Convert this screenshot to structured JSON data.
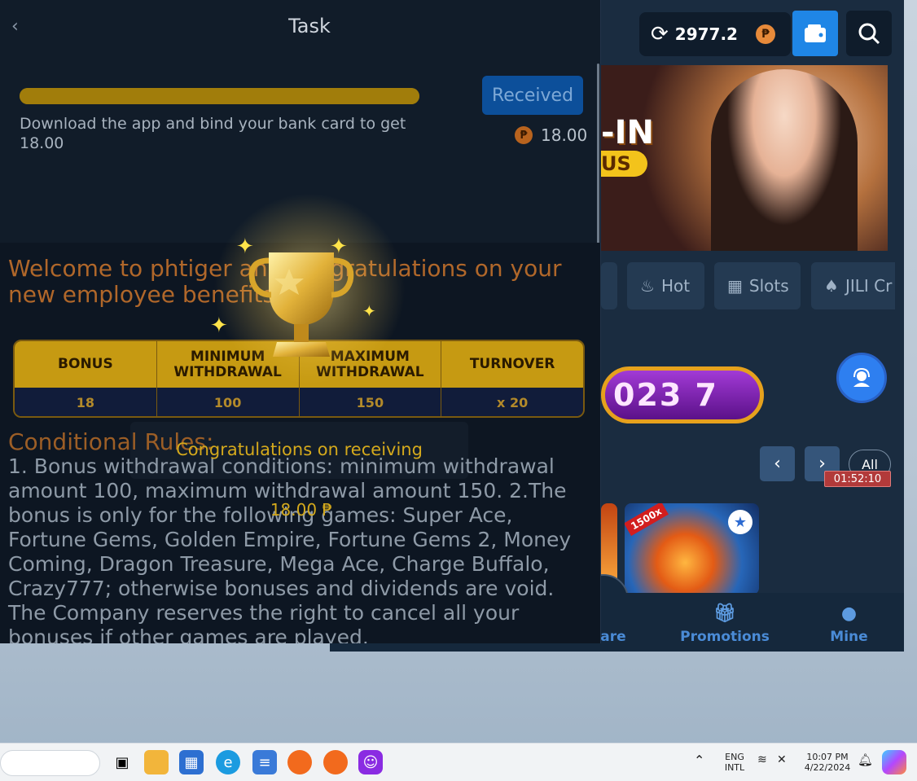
{
  "task_panel": {
    "title": "Task",
    "back_icon": "‹",
    "task": {
      "description": "Download the app and bind your bank card to get 18.00",
      "progress": 1.0,
      "button_label": "Received",
      "reward_amount": "18.00",
      "reward_currency_symbol": "₱"
    },
    "welcome": "Welcome to phtiger and congratulations on your new employee benefits",
    "bonus_table": {
      "headers": [
        "BONUS",
        "MINIMUM WITHDRAWAL",
        "MAXIMUM WITHDRAWAL",
        "TURNOVER"
      ],
      "values": [
        "18",
        "100",
        "150",
        "x 20"
      ]
    },
    "rules_title": "Conditional Rules:",
    "rules_text": "1. Bonus withdrawal conditions: minimum withdrawal amount 100, maximum withdrawal amount 150. 2.The bonus is only for the following games: Super Ace, Fortune Gems, Golden Empire, Fortune Gems 2, Money Coming, Dragon Treasure, Mega Ace, Charge Buffalo, Crazy777; otherwise bonuses and dividends are void. The Company reserves the right to cancel all your bonuses if other games are played.",
    "popup": {
      "message": "Congratulations on receiving",
      "amount": "18.00 ₱"
    }
  },
  "bg_app": {
    "balance": "2977.2",
    "currency_symbol": "₱",
    "banner_text": "-IN",
    "banner_badge": "US",
    "categories": [
      {
        "label": "Hot",
        "icon": "fire-icon"
      },
      {
        "label": "Slots",
        "icon": "slots-icon"
      },
      {
        "label": "JILI Cr",
        "icon": "cards-icon"
      }
    ],
    "jackpot_digits": "023  7",
    "all_label": "All",
    "timer": "01:52:10",
    "game_badge": "1500x",
    "bottom_nav": [
      {
        "label": "are",
        "icon": "share-icon"
      },
      {
        "label": "Promotions",
        "icon": "gift-icon"
      },
      {
        "label": "Mine",
        "icon": "user-icon"
      }
    ]
  },
  "taskbar": {
    "language": "ENG",
    "layout": "INTL",
    "time": "10:07 PM",
    "date": "4/22/2024"
  },
  "colors": {
    "panel_bg": "#111c29",
    "accent_gold": "#c69a12",
    "accent_blue": "#1f86e6",
    "orange_text": "#b0672a"
  }
}
